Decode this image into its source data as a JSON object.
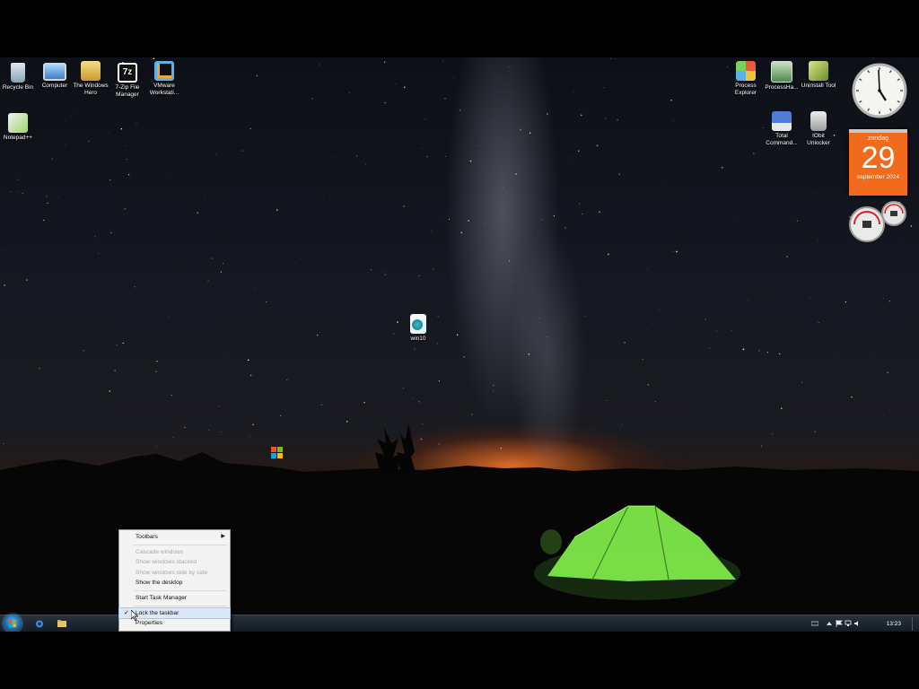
{
  "desktop_icons_left": [
    {
      "label": "Recycle Bin",
      "icon": "recycle-bin-icon",
      "color": "#9fb7c9"
    },
    {
      "label": "Computer",
      "icon": "computer-icon",
      "color": "#6aa9e0"
    },
    {
      "label": "The Windows Hero",
      "icon": "folder-icon",
      "color": "#e8c25a"
    },
    {
      "label": "7-Zip File Manager",
      "icon": "7zip-icon",
      "color": "#ffffff"
    },
    {
      "label": "VMware Workstati...",
      "icon": "vmware-icon",
      "color": "#5fb2e8"
    },
    {
      "label": "Notepad++",
      "icon": "notepadpp-icon",
      "color": "#8ccf5a"
    }
  ],
  "desktop_icons_right": [
    {
      "label": "Process Explorer",
      "icon": "process-explorer-icon",
      "color": "#e8a050"
    },
    {
      "label": "ProcessHa...",
      "icon": "process-hacker-icon",
      "color": "#6fa86f"
    },
    {
      "label": "Uninstall Tool",
      "icon": "uninstall-tool-icon",
      "color": "#9fb35c"
    },
    {
      "label": "Total Command...",
      "icon": "total-commander-icon",
      "color": "#4d7bd6"
    },
    {
      "label": "IObit Unlocker",
      "icon": "iobit-unlocker-icon",
      "color": "#c9c9c9"
    }
  ],
  "center_icon": {
    "label": "win10",
    "icon": "win10-file-icon"
  },
  "calendar": {
    "day_name": "zondag",
    "day": "29",
    "month_year": "september 2024"
  },
  "taskbar": {
    "time": "13:23"
  },
  "context_menu": {
    "items": [
      {
        "label": "Toolbars",
        "disabled": false,
        "submenu": true
      },
      {
        "label": "Cascade windows",
        "disabled": true
      },
      {
        "label": "Show windows stacked",
        "disabled": true
      },
      {
        "label": "Show windows side by side",
        "disabled": true
      },
      {
        "label": "Show the desktop",
        "disabled": false
      },
      {
        "label": "Start Task Manager",
        "disabled": false
      },
      {
        "label": "Lock the taskbar",
        "disabled": false,
        "checked": true
      },
      {
        "label": "Properties",
        "disabled": false
      }
    ]
  },
  "colors": {
    "calendar": "#f26a1b",
    "tent": "#7ee84a",
    "horizon_glow": "#ff7a28"
  }
}
